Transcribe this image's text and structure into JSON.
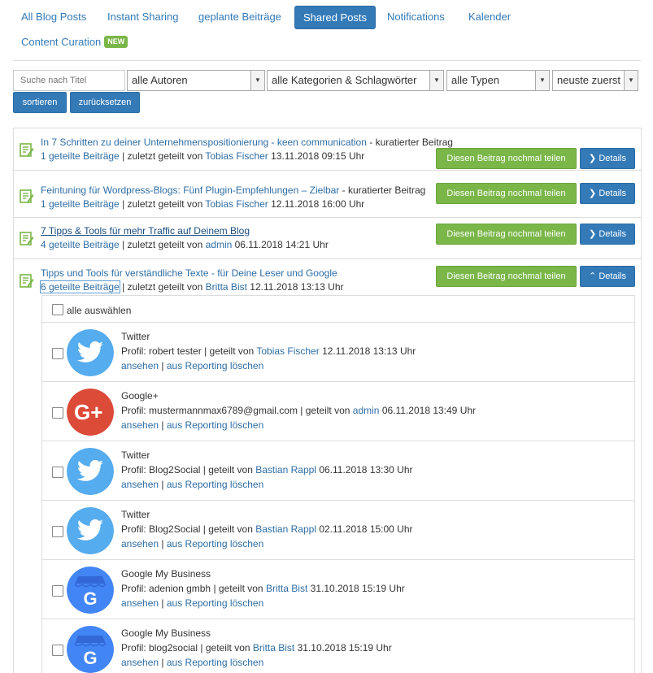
{
  "tabs": [
    {
      "label": "All Blog Posts",
      "active": false
    },
    {
      "label": "Instant Sharing",
      "active": false
    },
    {
      "label": "geplante Beiträge",
      "active": false
    },
    {
      "label": "Shared Posts",
      "active": true
    },
    {
      "label": "Notifications",
      "active": false
    },
    {
      "label": "Kalender",
      "active": false
    },
    {
      "label": "Content Curation",
      "active": false,
      "badge": "NEW"
    }
  ],
  "filters": {
    "search_placeholder": "Suche nach Titel",
    "authors": "alle Autoren",
    "categories": "alle Kategorien & Schlagwörter",
    "types": "alle Typen",
    "order": "neuste zuerst",
    "sort_label": "sortieren",
    "reset_label": "zurücksetzen"
  },
  "labels": {
    "share_again": "Diesen Beitrag nochmal teilen",
    "details": "Details",
    "last_shared_by": "| zuletzt geteilt von",
    "select_all": "alle auswählen",
    "profile_prefix": "Profil:",
    "shared_by": "| geteilt von",
    "view": "ansehen",
    "sep": "|",
    "delete_reporting": "aus Reporting löschen"
  },
  "posts": [
    {
      "title": "In 7 Schritten zu deiner Unternehmenspositionierung - keen communication",
      "suffix": "- kuratierter Beitrag",
      "count": "1 geteilte Beiträge",
      "user": "Tobias Fischer",
      "date": "13.11.2018 09:15 Uhr",
      "expanded": false
    },
    {
      "title": "Feintuning für Wordpress-Blogs: Fünf Plugin-Empfehlungen – Zielbar",
      "suffix": "- kuratierter Beitrag",
      "count": "1 geteilte Beiträge",
      "user": "Tobias Fischer",
      "date": "12.11.2018 16:00 Uhr",
      "expanded": false
    },
    {
      "title": "7 Tipps & Tools für mehr Traffic auf Deinem Blog",
      "suffix": "",
      "count": "4 geteilte Beiträge",
      "user": "admin",
      "date": "06.11.2018 14:21 Uhr",
      "expanded": false
    },
    {
      "title": "Tipps und Tools für verständliche Texte - für Deine Leser und Google",
      "suffix": "",
      "count": "6 geteilte Beiträge",
      "user": "Britta Bist",
      "date": "12.11.2018 13:13 Uhr",
      "expanded": true
    }
  ],
  "shares": [
    {
      "network": "Twitter",
      "icon": "twitter-icon",
      "profile": "robert tester",
      "user": "Tobias Fischer",
      "date": "12.11.2018 13:13 Uhr"
    },
    {
      "network": "Google+",
      "icon": "google-plus-icon",
      "profile": "mustermannmax6789@gmail.com",
      "user": "admin",
      "date": "06.11.2018 13:49 Uhr"
    },
    {
      "network": "Twitter",
      "icon": "twitter-icon",
      "profile": "Blog2Social",
      "user": "Bastian Rappl",
      "date": "06.11.2018 13:30 Uhr"
    },
    {
      "network": "Twitter",
      "icon": "twitter-icon",
      "profile": "Blog2Social",
      "user": "Bastian Rappl",
      "date": "02.11.2018 15:00 Uhr"
    },
    {
      "network": "Google My Business",
      "icon": "google-my-business-icon",
      "profile": "adenion gmbh",
      "user": "Britta Bist",
      "date": "31.10.2018 15:19 Uhr"
    },
    {
      "network": "Google My Business",
      "icon": "google-my-business-icon",
      "profile": "blog2social",
      "user": "Britta Bist",
      "date": "31.10.2018 15:19 Uhr"
    }
  ],
  "colors": {
    "primary": "#337ab7",
    "green": "#7ab648",
    "twitter": "#55acee",
    "gplus": "#dc4a38",
    "gmb": "#4285f4"
  }
}
